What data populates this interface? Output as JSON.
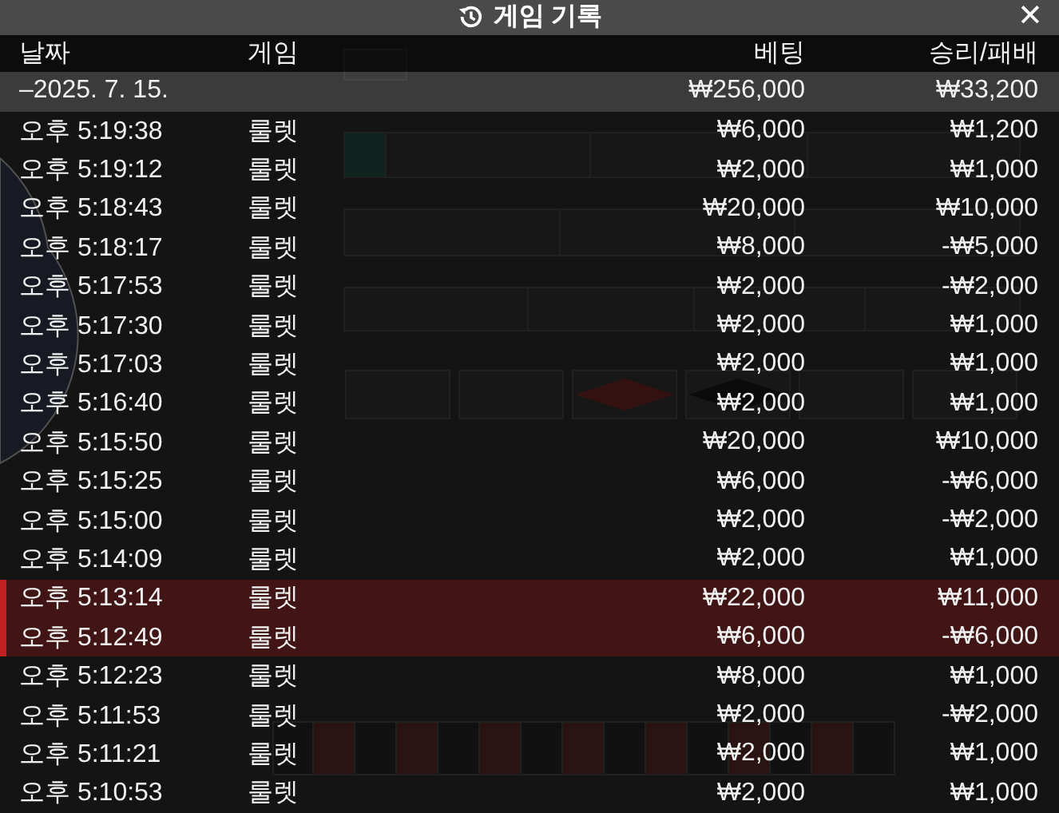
{
  "window": {
    "title": "게임 기록",
    "close": "✕"
  },
  "table": {
    "columns": [
      "날짜",
      "게임",
      "베팅",
      "승리/패배"
    ],
    "total": {
      "date": "–2025. 7. 15.",
      "bet": "₩256,000",
      "result": "₩33,200"
    },
    "rows": [
      {
        "time": "오후 5:19:38",
        "game": "룰렛",
        "bet": "₩6,000",
        "result": "₩1,200",
        "highlighted": false
      },
      {
        "time": "오후 5:19:12",
        "game": "룰렛",
        "bet": "₩2,000",
        "result": "₩1,000",
        "highlighted": false
      },
      {
        "time": "오후 5:18:43",
        "game": "룰렛",
        "bet": "₩20,000",
        "result": "₩10,000",
        "highlighted": false
      },
      {
        "time": "오후 5:18:17",
        "game": "룰렛",
        "bet": "₩8,000",
        "result": "-₩5,000",
        "highlighted": false
      },
      {
        "time": "오후 5:17:53",
        "game": "룰렛",
        "bet": "₩2,000",
        "result": "-₩2,000",
        "highlighted": false
      },
      {
        "time": "오후 5:17:30",
        "game": "룰렛",
        "bet": "₩2,000",
        "result": "₩1,000",
        "highlighted": false
      },
      {
        "time": "오후 5:17:03",
        "game": "룰렛",
        "bet": "₩2,000",
        "result": "₩1,000",
        "highlighted": false
      },
      {
        "time": "오후 5:16:40",
        "game": "룰렛",
        "bet": "₩2,000",
        "result": "₩1,000",
        "highlighted": false
      },
      {
        "time": "오후 5:15:50",
        "game": "룰렛",
        "bet": "₩20,000",
        "result": "₩10,000",
        "highlighted": false
      },
      {
        "time": "오후 5:15:25",
        "game": "룰렛",
        "bet": "₩6,000",
        "result": "-₩6,000",
        "highlighted": false
      },
      {
        "time": "오후 5:15:00",
        "game": "룰렛",
        "bet": "₩2,000",
        "result": "-₩2,000",
        "highlighted": false
      },
      {
        "time": "오후 5:14:09",
        "game": "룰렛",
        "bet": "₩2,000",
        "result": "₩1,000",
        "highlighted": false
      },
      {
        "time": "오후 5:13:14",
        "game": "룰렛",
        "bet": "₩22,000",
        "result": "₩11,000",
        "highlighted": true
      },
      {
        "time": "오후 5:12:49",
        "game": "룰렛",
        "bet": "₩6,000",
        "result": "-₩6,000",
        "highlighted": true
      },
      {
        "time": "오후 5:12:23",
        "game": "룰렛",
        "bet": "₩8,000",
        "result": "₩1,000",
        "highlighted": false
      },
      {
        "time": "오후 5:11:53",
        "game": "룰렛",
        "bet": "₩2,000",
        "result": "-₩2,000",
        "highlighted": false
      },
      {
        "time": "오후 5:11:21",
        "game": "룰렛",
        "bet": "₩2,000",
        "result": "₩1,000",
        "highlighted": false
      },
      {
        "time": "오후 5:10:53",
        "game": "룰렛",
        "bet": "₩2,000",
        "result": "₩1,000",
        "highlighted": false
      }
    ]
  }
}
